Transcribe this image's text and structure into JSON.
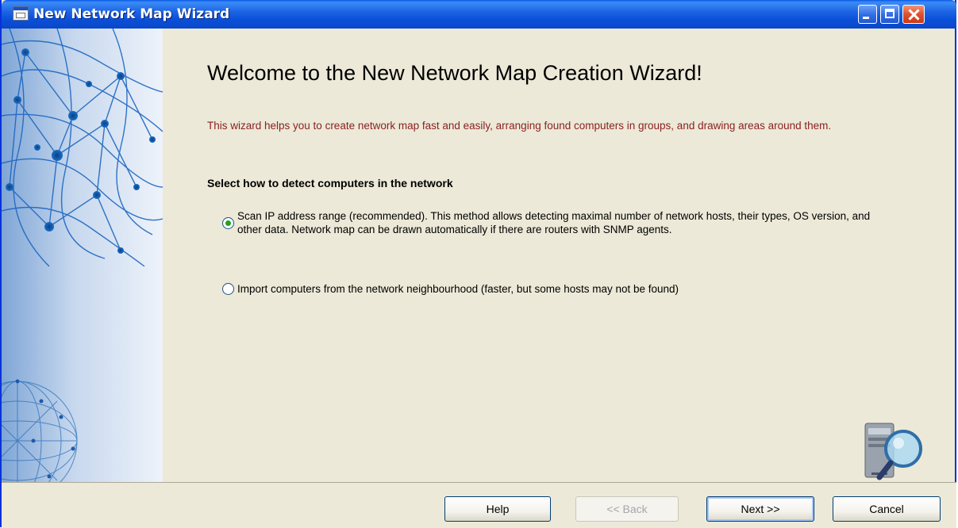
{
  "window": {
    "title": "New Network Map Wizard",
    "controls": [
      "minimize-icon",
      "maximize-icon",
      "close-icon"
    ]
  },
  "main": {
    "heading": "Welcome to the New Network Map Creation Wizard!",
    "intro": "This wizard helps you to create network map fast and easily, arranging found computers in groups, and drawing areas around them.",
    "section_title": "Select how to detect computers in the network",
    "options": [
      {
        "label": "Scan IP address range (recommended). This method allows detecting maximal number of network hosts, their types, OS version, and other data. Network map can be drawn automatically if there are routers with SNMP agents.",
        "selected": true
      },
      {
        "label": "Import computers from the network neighbourhood (faster, but some hosts may not be found)",
        "selected": false
      }
    ]
  },
  "buttons": {
    "help": "Help",
    "back": "<< Back",
    "next": "Next >>",
    "cancel": "Cancel"
  },
  "colors": {
    "titlebar": "#0a4fd8",
    "intro_text": "#8b1f1f",
    "radio_dot": "#21a121",
    "window_bg": "#ece9d8"
  }
}
